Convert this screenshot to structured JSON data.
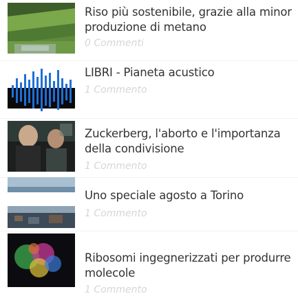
{
  "articles": [
    {
      "title": "Riso più sostenibile, grazie alla minor produzione di metano",
      "comments": "0 Commenti",
      "thumb_icon": "rice-field-image"
    },
    {
      "title": "LIBRI - Pianeta acustico",
      "comments": "1 Commento",
      "thumb_icon": "sound-waveform-image"
    },
    {
      "title": "Zuckerberg, l'aborto e l'importanza della condivisione",
      "comments": "1 Commento",
      "thumb_icon": "people-photo-image"
    },
    {
      "title": "Uno speciale agosto a Torino",
      "comments": "1 Commento",
      "thumb_icon": "city-river-image"
    },
    {
      "title": "Ribosomi ingegnerizzati per produrre molecole",
      "comments": "1 Commento",
      "thumb_icon": "ribosome-microscopy-image"
    }
  ],
  "colors": {
    "title": "#333333",
    "comments": "#d6d6d6",
    "background": "#ffffff"
  }
}
